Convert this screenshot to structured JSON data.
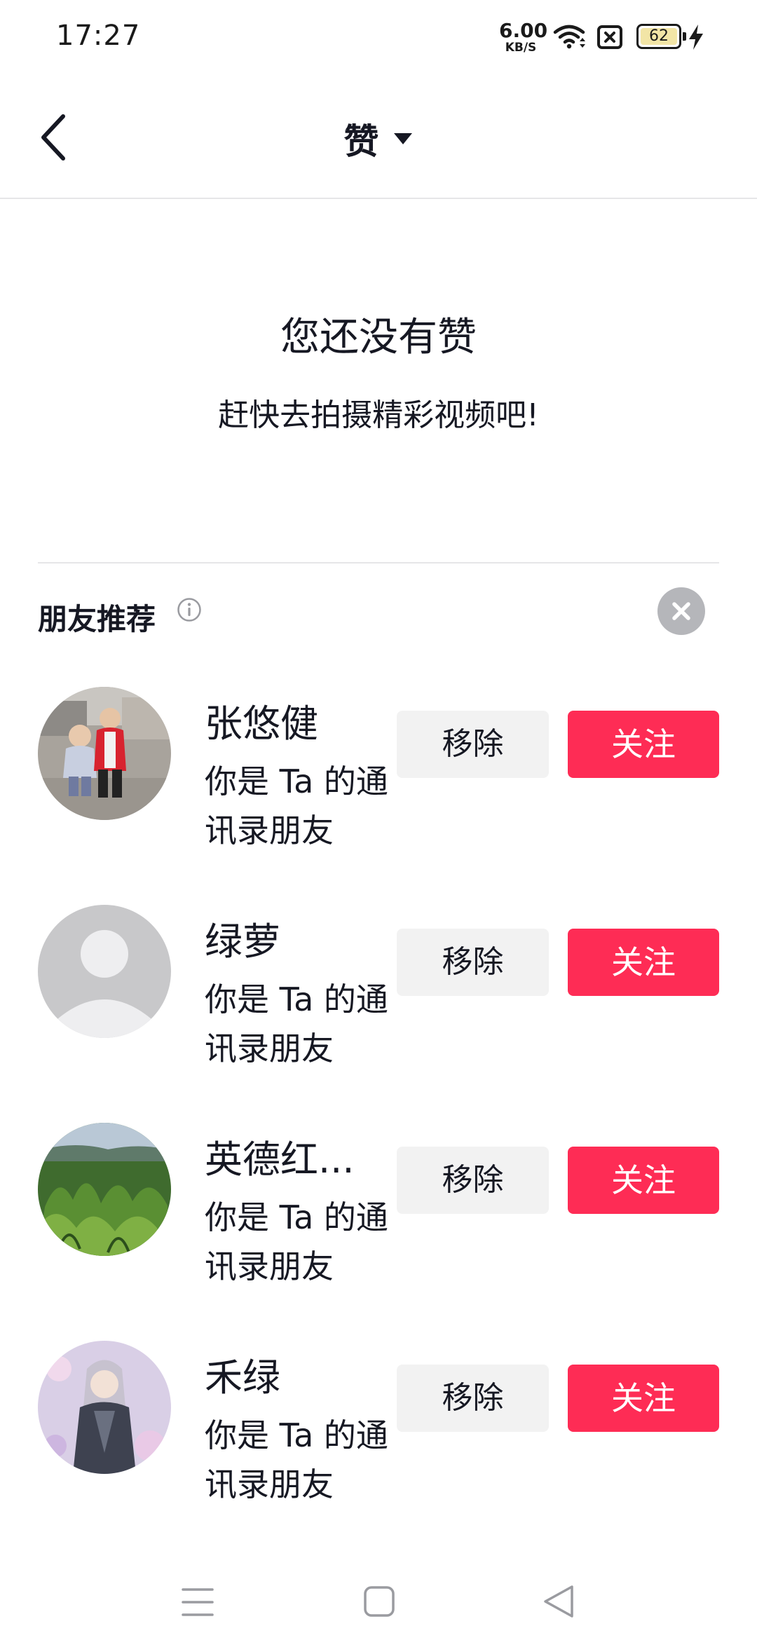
{
  "status_bar": {
    "time": "17:27",
    "net_speed_value": "6.00",
    "net_speed_unit": "KB/S",
    "battery_level": "62",
    "icons": [
      "wifi-icon",
      "no-sim-icon",
      "battery-icon",
      "charging-bolt-icon"
    ]
  },
  "header": {
    "title": "赞",
    "icons": [
      "back-chevron-icon",
      "caret-down-icon"
    ]
  },
  "empty_state": {
    "title": "您还没有赞",
    "subtitle": "赶快去拍摄精彩视频吧!"
  },
  "friends_section": {
    "title": "朋友推荐",
    "icons": [
      "info-icon",
      "close-icon"
    ],
    "items": [
      {
        "name": "张悠健",
        "desc": "你是 Ta 的通讯录朋友",
        "remove_label": "移除",
        "follow_label": "关注",
        "avatar": "photo-two-children"
      },
      {
        "name": "绿萝",
        "desc": "你是 Ta 的通讯录朋友",
        "remove_label": "移除",
        "follow_label": "关注",
        "avatar": "default-avatar"
      },
      {
        "name": "英德红...",
        "desc": "你是 Ta 的通讯录朋友",
        "remove_label": "移除",
        "follow_label": "关注",
        "avatar": "photo-tea-field"
      },
      {
        "name": "禾绿",
        "desc": "你是 Ta 的通讯录朋友",
        "remove_label": "移除",
        "follow_label": "关注",
        "avatar": "anime-character"
      }
    ]
  },
  "nav_bar": {
    "icons": [
      "menu-icon",
      "home-square-icon",
      "back-triangle-icon"
    ]
  },
  "colors": {
    "follow_button": "#fe2c55",
    "remove_button": "#f2f2f2",
    "text_primary": "#161823",
    "divider": "#e6e6e8"
  }
}
